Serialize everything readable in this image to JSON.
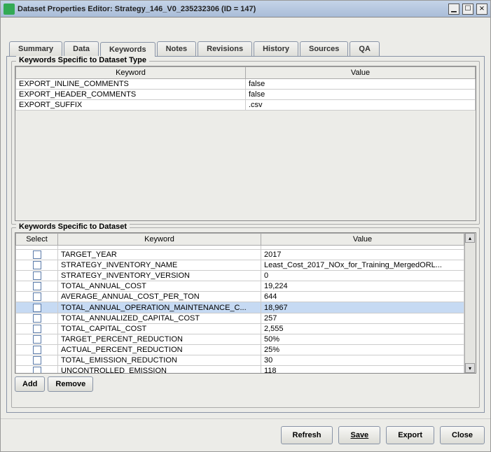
{
  "window": {
    "title": "Dataset Properties Editor: Strategy_146_V0_235232306 (ID = 147)"
  },
  "tabs": [
    "Summary",
    "Data",
    "Keywords",
    "Notes",
    "Revisions",
    "History",
    "Sources",
    "QA"
  ],
  "activeTab": "Keywords",
  "group1": {
    "title": "Keywords Specific to Dataset Type",
    "headers": {
      "keyword": "Keyword",
      "value": "Value"
    },
    "rows": [
      {
        "keyword": "EXPORT_INLINE_COMMENTS",
        "value": "false"
      },
      {
        "keyword": "EXPORT_HEADER_COMMENTS",
        "value": "false"
      },
      {
        "keyword": "EXPORT_SUFFIX",
        "value": ".csv"
      }
    ]
  },
  "group2": {
    "title": "Keywords Specific to Dataset",
    "headers": {
      "select": "Select",
      "keyword": "Keyword",
      "value": "Value"
    },
    "rows": [
      {
        "keyword": "TARGET_YEAR",
        "value": "2017",
        "selected": false
      },
      {
        "keyword": "STRATEGY_INVENTORY_NAME",
        "value": "Least_Cost_2017_NOx_for_Training_MergedORL...",
        "selected": false
      },
      {
        "keyword": "STRATEGY_INVENTORY_VERSION",
        "value": "0",
        "selected": false
      },
      {
        "keyword": "TOTAL_ANNUAL_COST",
        "value": "19,224",
        "selected": false
      },
      {
        "keyword": "AVERAGE_ANNUAL_COST_PER_TON",
        "value": "644",
        "selected": false
      },
      {
        "keyword": "TOTAL_ANNUAL_OPERATION_MAINTENANCE_C...",
        "value": "18,967",
        "selected": true
      },
      {
        "keyword": "TOTAL_ANNUALIZED_CAPITAL_COST",
        "value": "257",
        "selected": false
      },
      {
        "keyword": "TOTAL_CAPITAL_COST",
        "value": "2,555",
        "selected": false
      },
      {
        "keyword": "TARGET_PERCENT_REDUCTION",
        "value": "50%",
        "selected": false
      },
      {
        "keyword": "ACTUAL_PERCENT_REDUCTION",
        "value": "25%",
        "selected": false
      },
      {
        "keyword": "TOTAL_EMISSION_REDUCTION",
        "value": "30",
        "selected": false
      },
      {
        "keyword": "UNCONTROLLED_EMISSION",
        "value": "118",
        "selected": false
      }
    ]
  },
  "buttons": {
    "add": "Add",
    "remove": "Remove",
    "refresh": "Refresh",
    "save": "Save",
    "export": "Export",
    "close": "Close"
  }
}
